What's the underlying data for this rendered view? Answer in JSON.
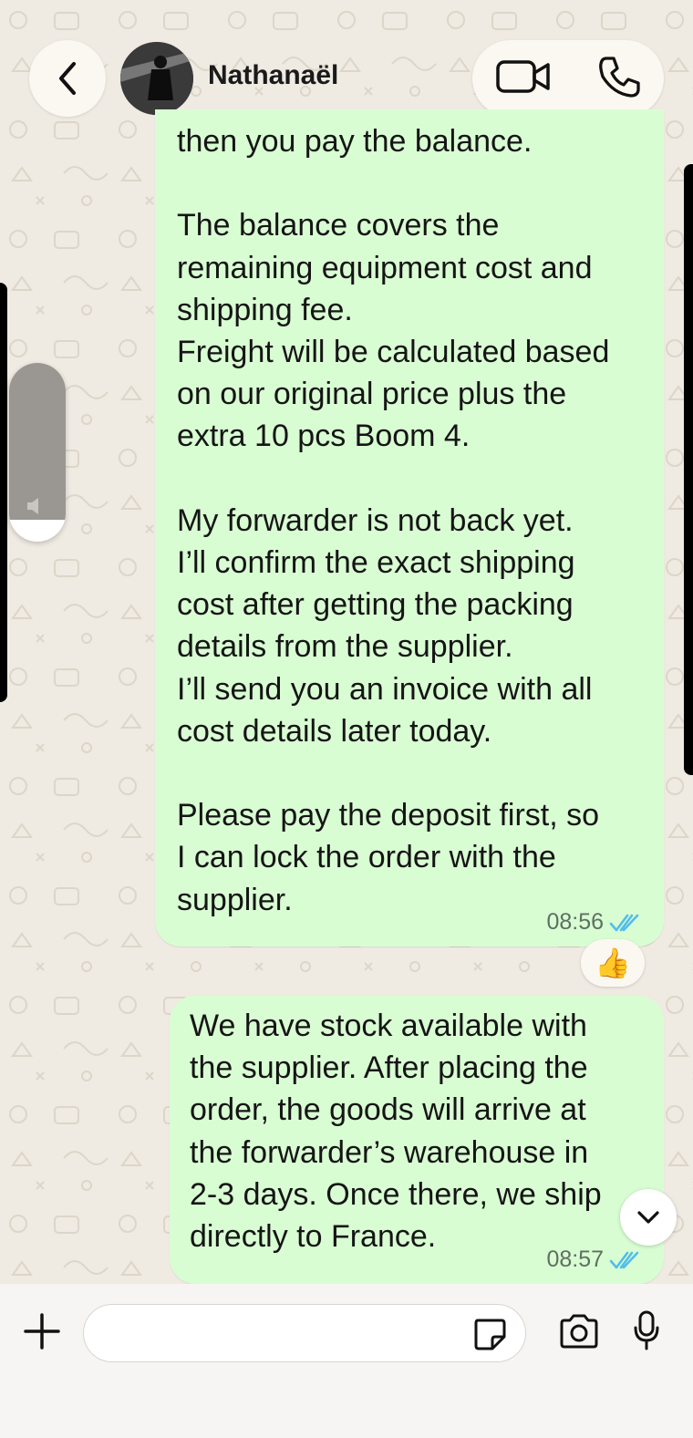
{
  "header": {
    "contact_name": "Nathanaël",
    "icons": {
      "back": "chevron-left-icon",
      "video": "video-call-icon",
      "phone": "phone-icon"
    }
  },
  "messages": [
    {
      "text": "then you pay the balance.\n\nThe balance covers the\nremaining equipment cost and\nshipping fee.\nFreight will be calculated based\non our original price plus the\nextra 10 pcs Boom 4.\n\nMy forwarder is not back yet.\nI’ll confirm the exact shipping\ncost after getting the packing\ndetails from the supplier.\nI’ll send you an invoice with all\ncost details later today.\n\nPlease pay the deposit first, so\nI can lock the order with the\nsupplier.",
      "time": "08:56",
      "status": "read",
      "reaction": "👍"
    },
    {
      "text": "We have stock available with\nthe supplier. After placing the\norder, the goods will arrive at\nthe forwarder’s warehouse in\n2-3 days. Once there, we ship\ndirectly to France.",
      "time": "08:57",
      "status": "read"
    }
  ],
  "composer": {
    "value": "",
    "icons": {
      "add": "plus-icon",
      "sticker": "sticker-icon",
      "camera": "camera-icon",
      "mic": "microphone-icon"
    }
  },
  "overlays": {
    "volume_level": 0.88,
    "scroll_down_icon": "chevron-down-icon"
  },
  "colors": {
    "outgoing_bubble": "#d9fdd3",
    "read_ticks": "#53bdeb",
    "wallpaper": "#efeae2"
  }
}
